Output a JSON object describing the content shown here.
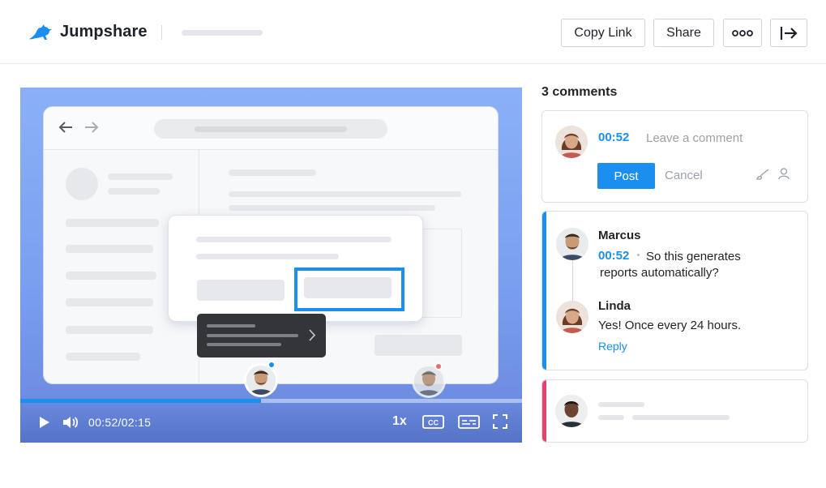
{
  "header": {
    "app_name": "Jumpshare",
    "buttons": {
      "copy_link": "Copy Link",
      "share": "Share",
      "more_icon": "more-dots-icon",
      "exit_icon": "exit-arrow-icon"
    }
  },
  "player": {
    "current_time": "00:52",
    "duration": "02:15",
    "time_display": "00:52/02:15",
    "speed": "1x",
    "cc_label": "CC",
    "progress": 0.48,
    "icons": [
      "play-icon",
      "volume-icon",
      "captions-icon",
      "subtitles-icon",
      "fullscreen-icon"
    ],
    "markers": [
      {
        "user": "Marcus",
        "dot_color": "#1b8ff0"
      },
      {
        "user": "commenter",
        "dot_color": "#f26b6b"
      }
    ]
  },
  "comments": {
    "title": "3 comments",
    "composer": {
      "timestamp": "00:52",
      "placeholder": "Leave a comment",
      "post_label": "Post",
      "cancel_label": "Cancel",
      "icons": [
        "draw-icon",
        "mention-icon"
      ]
    },
    "thread": {
      "accent_color": "#1b8ff0",
      "items": [
        {
          "name": "Marcus",
          "timestamp": "00:52",
          "text_line1": "So this generates",
          "text_line2": "reports automatically?"
        },
        {
          "name": "Linda",
          "text": "Yes! Once every 24 hours.",
          "reply_label": "Reply"
        }
      ]
    },
    "placeholder_card": {
      "accent_color": "#e8436f"
    }
  },
  "colors": {
    "brand_blue": "#1b8ff0",
    "video_bg": "#7fa5f3"
  }
}
